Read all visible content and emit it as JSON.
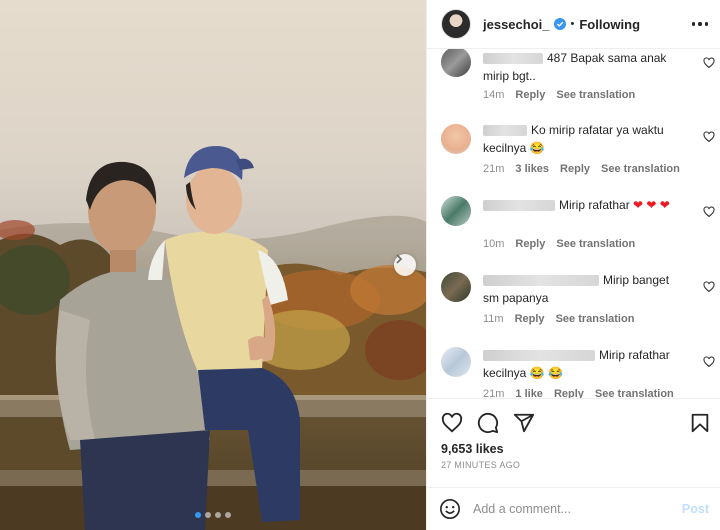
{
  "post": {
    "image_alt": "Vintage photo of a man and a young boy in a cap sitting on a wooden rail in front of autumn forest",
    "carousel": {
      "total": 4,
      "active": 0
    }
  },
  "header": {
    "username": "jessechoi_",
    "separator": "•",
    "follow_status": "Following"
  },
  "comments": [
    {
      "user_visible": "487",
      "text": "Bapak sama anak mirip bgt..",
      "time": "14m",
      "likes": "",
      "reply": "Reply",
      "translate": "See translation"
    },
    {
      "user_visible": "",
      "text": "Ko mirip rafatar ya waktu kecilnya",
      "emoji": "😂",
      "time": "21m",
      "likes": "3 likes",
      "reply": "Reply",
      "translate": "See translation"
    },
    {
      "user_visible": "",
      "text": "Mirip rafathar",
      "emoji": "❤ ❤ ❤",
      "time": "10m",
      "likes": "",
      "reply": "Reply",
      "translate": "See translation"
    },
    {
      "user_visible": "",
      "text": "Mirip banget sm papanya",
      "time": "11m",
      "likes": "",
      "reply": "Reply",
      "translate": "See translation"
    },
    {
      "user_visible": "",
      "text": "Mirip rafathar kecilnya",
      "emoji": "😂 😂",
      "time": "21m",
      "likes": "1 like",
      "reply": "Reply",
      "translate": "See translation"
    }
  ],
  "stats": {
    "likes": "9,653 likes",
    "time_ago": "27 MINUTES AGO"
  },
  "add_comment": {
    "placeholder": "Add a comment...",
    "post_label": "Post"
  },
  "colors": {
    "accent": "#3797f0",
    "text": "#262626",
    "muted": "#8e8e8e",
    "heart_red": "#ed1c24",
    "post_disabled": "#c0dffd"
  },
  "icons": [
    "verified-badge-icon",
    "more-options-icon",
    "heart-icon",
    "comment-icon",
    "share-icon",
    "bookmark-icon",
    "emoji-icon",
    "chevron-right-icon"
  ]
}
